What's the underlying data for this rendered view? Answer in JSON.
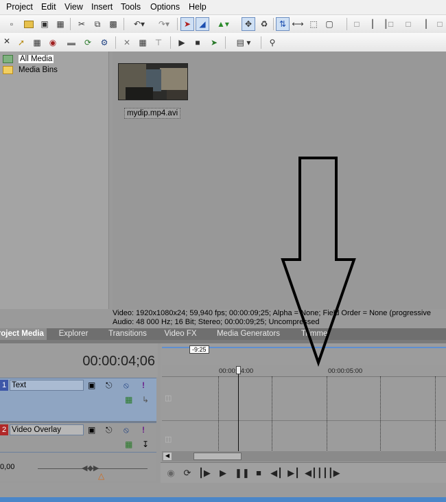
{
  "menu": [
    "Project",
    "Edit",
    "View",
    "Insert",
    "Tools",
    "Options",
    "Help"
  ],
  "toolbar1": [
    {
      "icon": "new-project-icon"
    },
    {
      "icon": "open-icon"
    },
    {
      "icon": "save-icon"
    },
    {
      "icon": "properties-icon"
    },
    {
      "icon": "cut-icon"
    },
    {
      "icon": "copy-icon"
    },
    {
      "icon": "paste-icon"
    },
    {
      "icon": "undo-icon"
    },
    {
      "icon": "redo-icon"
    },
    {
      "icon": "normal-edit-tool-icon"
    },
    {
      "icon": "envelope-tool-icon"
    },
    {
      "icon": "render-icon"
    },
    {
      "icon": "auto-ripple-icon"
    },
    {
      "icon": "snapping-icon"
    },
    {
      "icon": "auto-crossfade-icon"
    },
    {
      "icon": "lock-envelopes-icon"
    },
    {
      "icon": "ignore-grouping-icon"
    },
    {
      "icon": "split-icon"
    }
  ],
  "toolbar2": [
    {
      "icon": "import-media-icon"
    },
    {
      "icon": "capture-video-icon"
    },
    {
      "icon": "get-media-web-icon"
    },
    {
      "icon": "refresh-icon"
    },
    {
      "icon": "search-media-icon"
    },
    {
      "icon": "remove-media-icon"
    },
    {
      "icon": "media-properties-icon"
    },
    {
      "icon": "media-fx-icon"
    },
    {
      "icon": "play-icon"
    },
    {
      "icon": "stop-icon"
    },
    {
      "icon": "auto-preview-icon"
    },
    {
      "icon": "views-icon"
    },
    {
      "icon": "search-icon"
    }
  ],
  "tree": {
    "items": [
      {
        "label": "All Media"
      },
      {
        "label": "Media Bins"
      }
    ]
  },
  "media": {
    "clip_name": "mydip.mp4.avi"
  },
  "info": {
    "line1": "Video: 1920x1080x24; 59,940 fps; 00:00:09;25; Alpha = None; Field Order = None (progressive",
    "line2": "Audio: 48 000 Hz; 16 Bit; Stereo; 00:00:09;25; Uncompressed"
  },
  "tabs": [
    {
      "label": "Project Media",
      "active": true
    },
    {
      "label": "Explorer"
    },
    {
      "label": "Transitions"
    },
    {
      "label": "Video FX"
    },
    {
      "label": "Media Generators"
    },
    {
      "label": "Trimmer"
    }
  ],
  "timeline": {
    "timecode": "00:00:04;06",
    "marker": "-9:25",
    "ruler": [
      "00:00:04:00",
      "00:00:05:00"
    ],
    "zoom_value": "0,00",
    "tracks": [
      {
        "number": "1",
        "name": "Text",
        "color": "#3d57a8"
      },
      {
        "number": "2",
        "name": "Video Overlay",
        "color": "#b02828"
      }
    ]
  },
  "transport": [
    {
      "icon": "record-icon"
    },
    {
      "icon": "loop-playback-icon"
    },
    {
      "icon": "play-from-start-icon"
    },
    {
      "icon": "play-icon"
    },
    {
      "icon": "pause-icon"
    },
    {
      "icon": "stop-icon"
    },
    {
      "icon": "go-to-start-icon"
    },
    {
      "icon": "go-to-end-icon"
    },
    {
      "icon": "previous-frame-icon"
    },
    {
      "icon": "next-frame-icon"
    }
  ],
  "annotation": {
    "arrow_color": "#000000",
    "direction": "down"
  }
}
